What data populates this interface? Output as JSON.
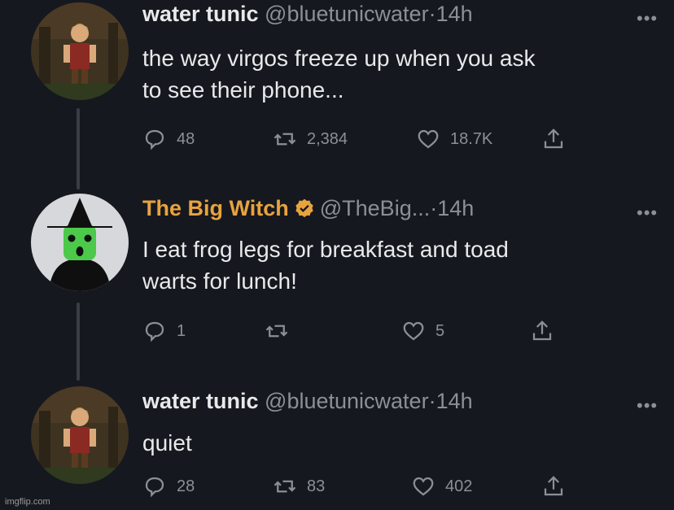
{
  "tweets": [
    {
      "name": "water tunic",
      "handle": "@bluetunicwater",
      "separator": "·",
      "time": "14h",
      "text_lines": [
        "the way virgos freeze up when you ask",
        "to see their phone..."
      ],
      "replies": "48",
      "retweets": "2,384",
      "likes": "18.7K",
      "avatar_icon": "link-character-avatar"
    },
    {
      "name": "The Big Witch",
      "handle": "@TheBig...",
      "separator": "·",
      "time": "14h",
      "text_lines": [
        "I eat frog legs for breakfast and toad",
        "warts for lunch!"
      ],
      "replies": "1",
      "retweets": "",
      "likes": "5",
      "verified": true,
      "name_color": "#e8a33d",
      "avatar_icon": "green-witch-avatar"
    },
    {
      "name": "water tunic",
      "handle": "@bluetunicwater",
      "separator": "·",
      "time": "14h",
      "text_lines": [
        "quiet"
      ],
      "replies": "28",
      "retweets": "83",
      "likes": "402",
      "avatar_icon": "link-character-avatar"
    }
  ],
  "more_label": "•••",
  "watermark": "imgflip.com",
  "colors": {
    "background": "#16181f",
    "text": "#e7e9ea",
    "muted": "#8b9096",
    "witch_name": "#e8a33d"
  }
}
